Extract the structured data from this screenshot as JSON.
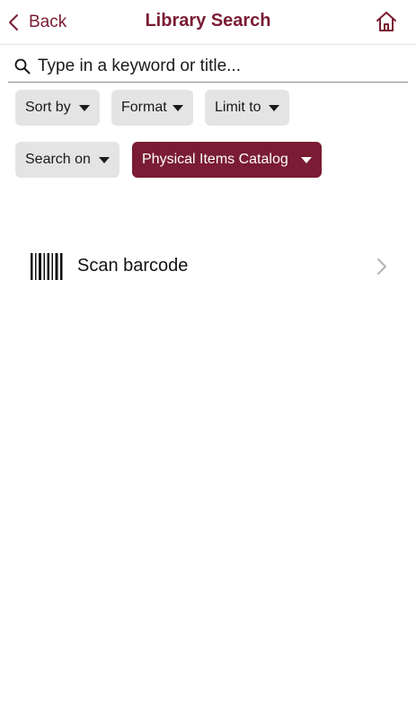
{
  "header": {
    "back_label": "Back",
    "title": "Library Search",
    "back_icon": "chevron-left-icon",
    "home_icon": "home-icon"
  },
  "search": {
    "placeholder": "Type in a keyword or title...",
    "value": "",
    "icon": "search-icon"
  },
  "filters": {
    "sort_by": "Sort by",
    "format": "Format",
    "limit_to": "Limit to",
    "search_on": "Search on",
    "catalog": "Physical Items Catalog"
  },
  "scan": {
    "label": "Scan barcode",
    "icon": "barcode-icon",
    "chevron_icon": "chevron-right-icon"
  },
  "colors": {
    "accent": "#7a1c33",
    "chip_bg": "#e4e4e4",
    "divider": "#e6e6e6"
  }
}
